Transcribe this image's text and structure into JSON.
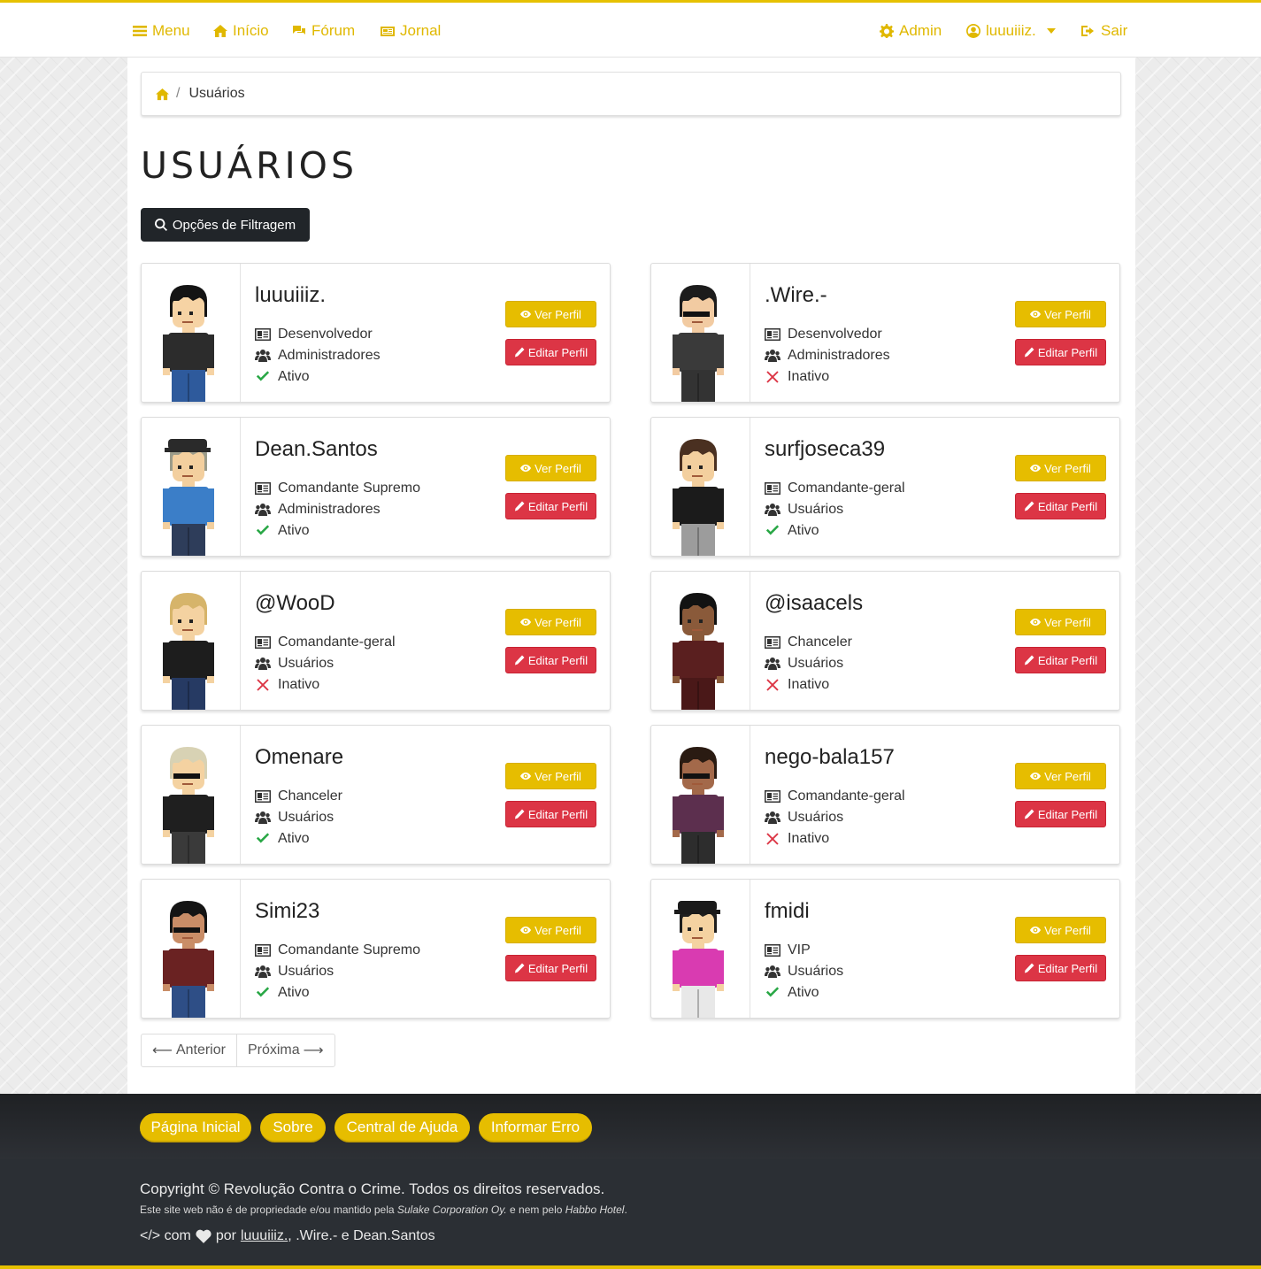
{
  "nav": {
    "menu": "Menu",
    "inicio": "Início",
    "forum": "Fórum",
    "jornal": "Jornal",
    "admin": "Admin",
    "user": "luuuiiiz.",
    "sair": "Sair"
  },
  "breadcrumb": {
    "current": "Usuários",
    "separator": "/"
  },
  "page_title": "USUÁRIOS",
  "filter_button": "Opções de Filtragem",
  "buttons": {
    "view": "Ver Perfil",
    "edit": "Editar Perfil"
  },
  "users": [
    {
      "name": "luuuiiiz.",
      "role": "Desenvolvedor",
      "group": "Administradores",
      "status": "Ativo",
      "active": true
    },
    {
      "name": ".Wire.-",
      "role": "Desenvolvedor",
      "group": "Administradores",
      "status": "Inativo",
      "active": false
    },
    {
      "name": "Dean.Santos",
      "role": "Comandante Supremo",
      "group": "Administradores",
      "status": "Ativo",
      "active": true
    },
    {
      "name": "surfjoseca39",
      "role": "Comandante-geral",
      "group": "Usuários",
      "status": "Ativo",
      "active": true
    },
    {
      "name": "@WooD",
      "role": "Comandante-geral",
      "group": "Usuários",
      "status": "Inativo",
      "active": false
    },
    {
      "name": "@isaacels",
      "role": "Chanceler",
      "group": "Usuários",
      "status": "Inativo",
      "active": false
    },
    {
      "name": "Omenare",
      "role": "Chanceler",
      "group": "Usuários",
      "status": "Ativo",
      "active": true
    },
    {
      "name": "nego-bala157",
      "role": "Comandante-geral",
      "group": "Usuários",
      "status": "Inativo",
      "active": false
    },
    {
      "name": "Simi23",
      "role": "Comandante Supremo",
      "group": "Usuários",
      "status": "Ativo",
      "active": true
    },
    {
      "name": "fmidi",
      "role": "VIP",
      "group": "Usuários",
      "status": "Ativo",
      "active": true
    }
  ],
  "pagination": {
    "prev": "Anterior",
    "next": "Próxima"
  },
  "footer": {
    "links": [
      "Página Inicial",
      "Sobre",
      "Central de Ajuda",
      "Informar Erro"
    ],
    "copyright": "Copyright © Revolução Contra o Crime. Todos os direitos reservados.",
    "disclaimer_a": "Este site web não é de propriedade e/ou mantido pela ",
    "disclaimer_b": "Sulake Corporation Oy.",
    "disclaimer_c": " e nem pelo ",
    "disclaimer_d": "Habbo Hotel",
    "disclaimer_e": ".",
    "credits_com": "</> com",
    "credits_por": "por",
    "credits_u1": "luuuiiiz.",
    "credits_rest": ", .Wire.- e Dean.Santos"
  },
  "colors": {
    "accent": "#e6bd00",
    "danger": "#dc3545",
    "success": "#28a745",
    "dark": "#212529"
  },
  "avatars": [
    {
      "hair": "#141414",
      "skin": "#f6d3a4",
      "shirt": "#2c2c2c",
      "pants": "#2e5a9c",
      "glasses": false,
      "hat": ""
    },
    {
      "hair": "#1c1c1c",
      "skin": "#f2cba2",
      "shirt": "#3a3a3a",
      "pants": "#333333",
      "glasses": true,
      "hat": ""
    },
    {
      "hair": "#9c9c8a",
      "skin": "#f3cf9e",
      "shirt": "#3b7ec8",
      "pants": "#2e3d5a",
      "glasses": false,
      "hat": "#2a2a2a"
    },
    {
      "hair": "#4a3021",
      "skin": "#f3cf9e",
      "shirt": "#1b1b1b",
      "pants": "#9c9c9c",
      "glasses": false,
      "hat": ""
    },
    {
      "hair": "#d6b46a",
      "skin": "#f4d2a1",
      "shirt": "#1d1d1d",
      "pants": "#263a63",
      "glasses": false,
      "hat": ""
    },
    {
      "hair": "#121212",
      "skin": "#8a5a3a",
      "shirt": "#5a1f1f",
      "pants": "#4a1818",
      "glasses": false,
      "hat": ""
    },
    {
      "hair": "#d8d2b4",
      "skin": "#f4d2a1",
      "shirt": "#1f1f1f",
      "pants": "#3a3a3a",
      "glasses": true,
      "hat": ""
    },
    {
      "hair": "#2a1b12",
      "skin": "#a3694a",
      "shirt": "#5c2f4e",
      "pants": "#2d2d2d",
      "glasses": true,
      "hat": ""
    },
    {
      "hair": "#141414",
      "skin": "#c98d67",
      "shirt": "#6a2222",
      "pants": "#2e4e86",
      "glasses": true,
      "hat": ""
    },
    {
      "hair": "#1e1e1e",
      "skin": "#f4d2a1",
      "shirt": "#d93bb1",
      "pants": "#e8e8e8",
      "glasses": false,
      "hat": "#1a1a1a"
    }
  ]
}
